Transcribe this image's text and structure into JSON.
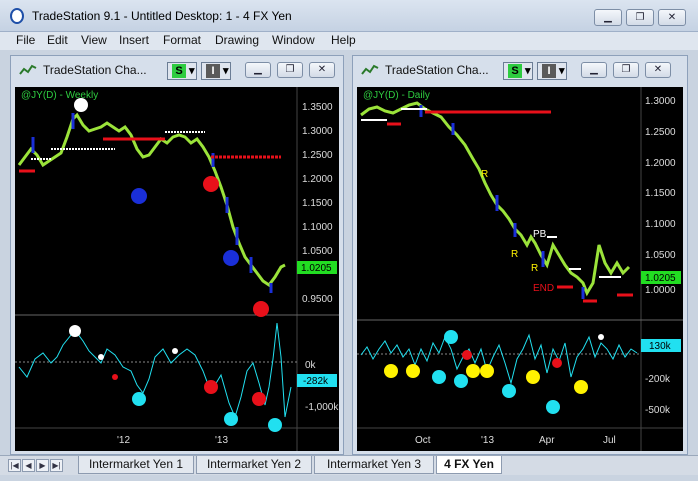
{
  "app": {
    "title": "TradeStation 9.1 - Untitled Desktop: 1 - 4 FX Yen"
  },
  "menu": [
    "File",
    "Edit",
    "View",
    "Insert",
    "Format",
    "Drawing",
    "Window",
    "Help"
  ],
  "windows": [
    {
      "title": "TradeStation Cha...",
      "s_label": "S",
      "i_label": "I",
      "symbol_label": "@JY(D) - Weekly",
      "price_ticks": [
        "1.3500",
        "1.3000",
        "1.2500",
        "1.2000",
        "1.1500",
        "1.1000",
        "1.0500",
        "0.9500"
      ],
      "price_badge": "1.0205",
      "ind_ticks": [
        "0k",
        "-1,000k"
      ],
      "ind_badge": "-282k",
      "x_ticks": [
        "'12",
        "'13"
      ]
    },
    {
      "title": "TradeStation Cha...",
      "s_label": "S",
      "i_label": "I",
      "symbol_label": "@JY(D) - Daily",
      "price_ticks": [
        "1.3000",
        "1.2500",
        "1.2000",
        "1.1500",
        "1.1000",
        "1.0500",
        "1.0000"
      ],
      "price_badge": "1.0205",
      "ind_ticks": [
        "-200k",
        "-500k"
      ],
      "ind_badge": "130k",
      "x_ticks": [
        "Oct",
        "'13",
        "Apr",
        "Jul"
      ],
      "annotations": [
        "R",
        "PB",
        "R",
        "R",
        "END"
      ]
    }
  ],
  "tabs": [
    "Intermarket Yen 1",
    "Intermarket Yen 2",
    "Intermarket Yen 3",
    "4 FX Yen"
  ],
  "colors": {
    "bull": "#9be33a",
    "bear": "#1a2fd8",
    "red_line": "#e8101a",
    "white_line": "#ffffff",
    "cyan": "#21e0f0",
    "yellow": "#fff200",
    "price_badge_bg": "#22dd22"
  }
}
